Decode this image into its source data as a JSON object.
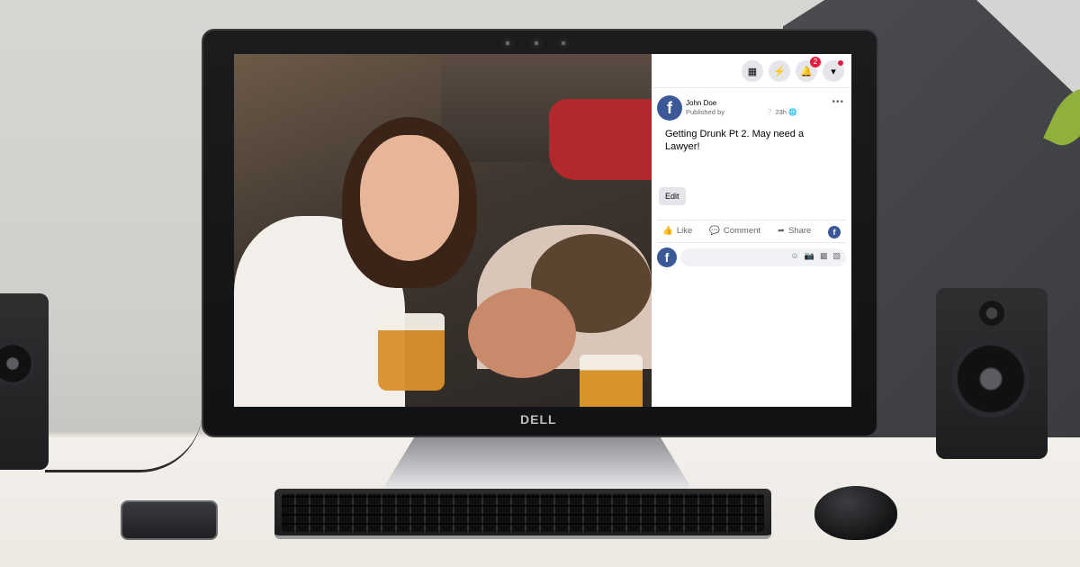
{
  "monitor": {
    "brand": "DELL"
  },
  "facebook": {
    "topbar": {
      "menu_icon": "grid-icon",
      "messenger_icon": "messenger-icon",
      "notifications_icon": "bell-icon",
      "notifications_count": "2",
      "account_icon": "caret-down-icon"
    },
    "post": {
      "author": "John Doe",
      "published_by": "Published by",
      "time": "23h",
      "more": "•••",
      "text": "Getting Drunk Pt 2. May need a Lawyer!",
      "edit_label": "Edit"
    },
    "actions": {
      "like": "Like",
      "comment": "Comment",
      "share": "Share"
    },
    "comment_box": {
      "placeholder": ""
    },
    "colors": {
      "brand": "#3b5998",
      "badge": "#e41e3f",
      "secondary_text": "#65676b",
      "button_bg": "#e4e6eb"
    }
  }
}
